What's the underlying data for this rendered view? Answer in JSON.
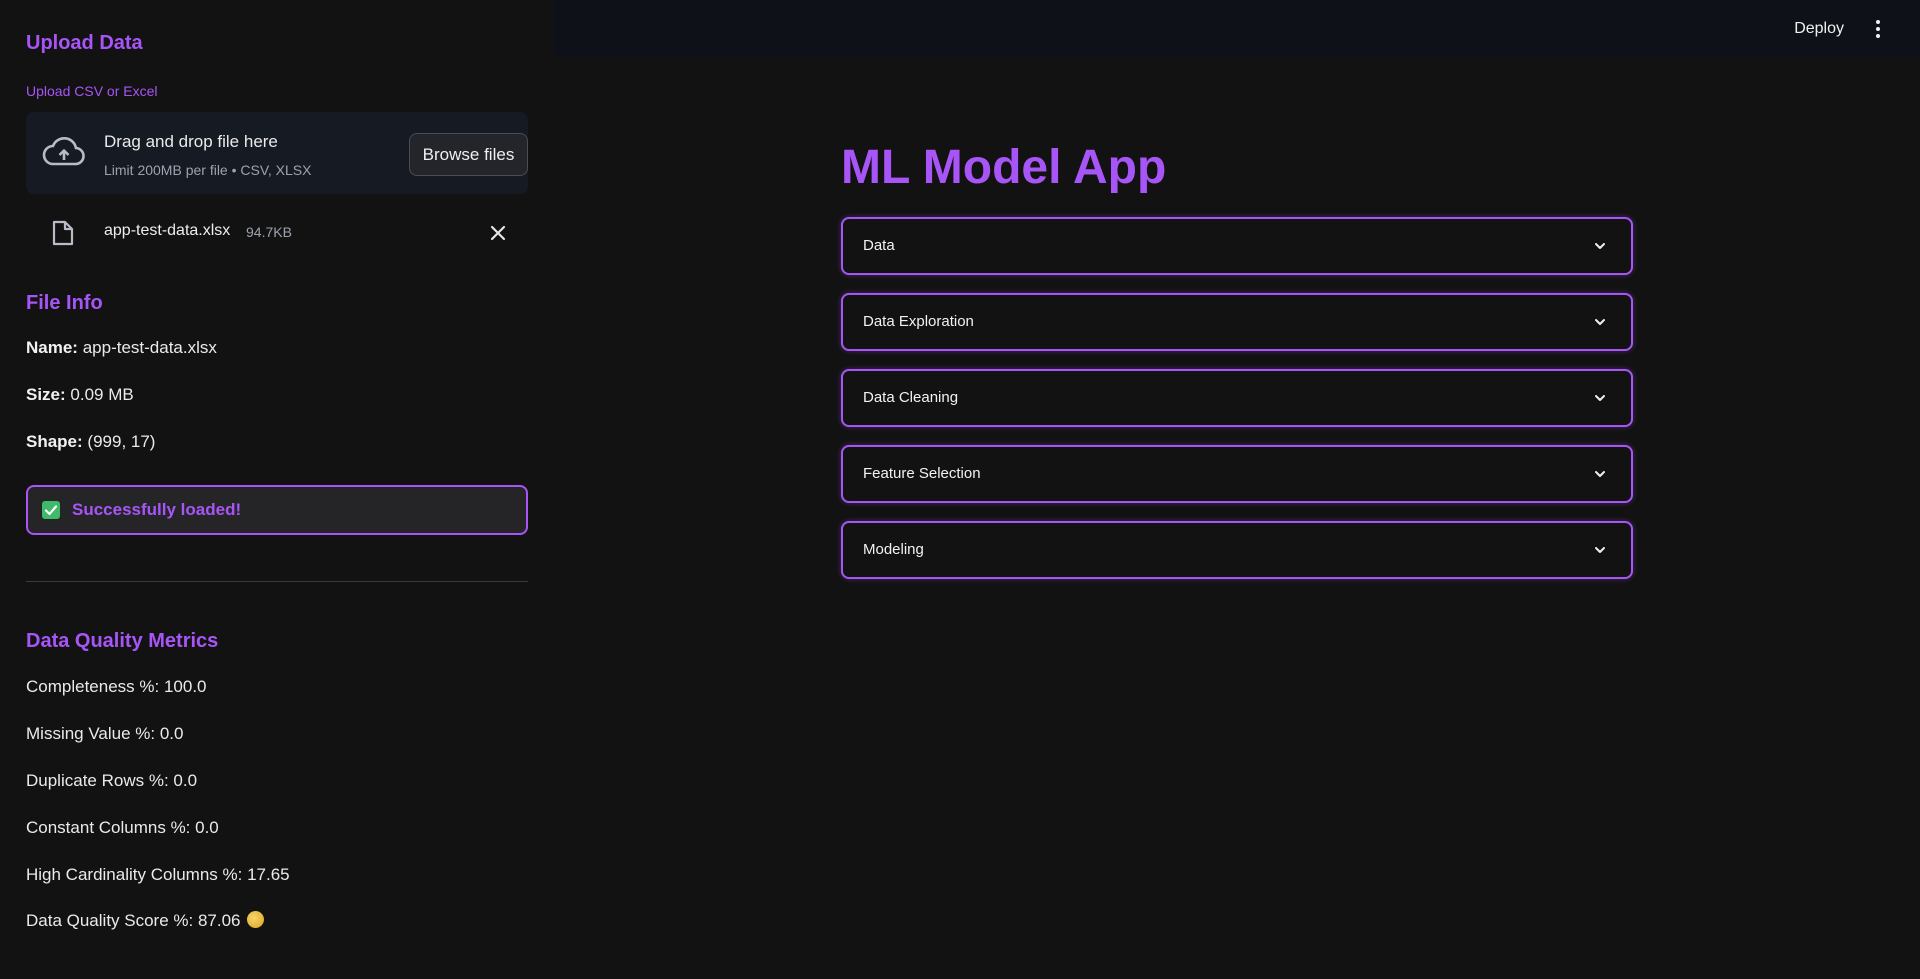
{
  "sidebar": {
    "upload_heading": "Upload Data",
    "upload_label": "Upload CSV or Excel",
    "dropzone": {
      "title": "Drag and drop file here",
      "subtitle": "Limit 200MB per file • CSV, XLSX",
      "browse_label": "Browse files"
    },
    "uploaded_file": {
      "name": "app-test-data.xlsx",
      "size": "94.7KB"
    },
    "file_info_heading": "File Info",
    "file_info": {
      "name_label": "Name:",
      "name_value": "app-test-data.xlsx",
      "size_label": "Size:",
      "size_value": "0.09 MB",
      "shape_label": "Shape:",
      "shape_value": "(999, 17)"
    },
    "success_message": "Successfully loaded!",
    "metrics_heading": "Data Quality Metrics",
    "metrics": [
      "Completeness %: 100.0",
      "Missing Value %: 0.0",
      "Duplicate Rows %: 0.0",
      "Constant Columns %: 0.0",
      "High Cardinality Columns %: 17.65",
      "Data Quality Score %: 87.06"
    ],
    "score_icon": "coin-icon"
  },
  "header": {
    "deploy_label": "Deploy",
    "menu_icon": "kebab-menu-icon"
  },
  "main": {
    "title": "ML Model App",
    "expanders": [
      "Data",
      "Data Exploration",
      "Data Cleaning",
      "Feature Selection",
      "Modeling"
    ]
  },
  "colors": {
    "accent": "#a855f7",
    "background": "#121212",
    "header_bg": "#0e1117",
    "success_check": "#3dbb6a"
  }
}
